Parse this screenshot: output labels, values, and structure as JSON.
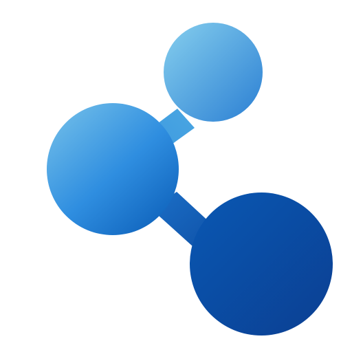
{
  "icon": {
    "name": "share-network-icon",
    "colors": {
      "light_start": "#7cc6e8",
      "light_mid": "#2f8fd9",
      "dark_start": "#0d62c4",
      "dark_end": "#0b3f93"
    }
  }
}
